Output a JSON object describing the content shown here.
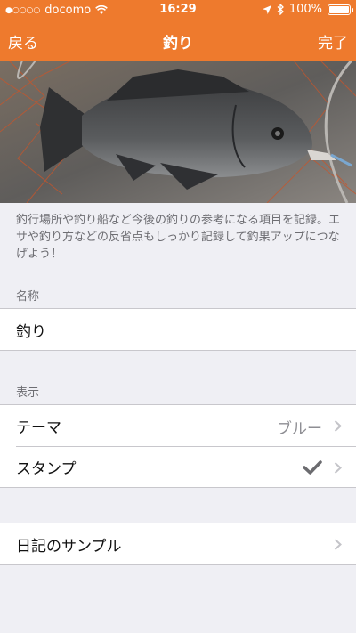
{
  "status_bar": {
    "carrier": "docomo",
    "time": "16:29",
    "battery": "100%"
  },
  "nav": {
    "back_label": "戻る",
    "title": "釣り",
    "done_label": "完了"
  },
  "description": "釣行場所や釣り船など今後の釣りの参考になる項目を記録。エサや釣り方などの反省点もしっかり記録して釣果アップにつなげよう！",
  "name_section": {
    "header": "名称",
    "value": "釣り"
  },
  "display_section": {
    "header": "表示",
    "theme_label": "テーマ",
    "theme_value": "ブルー",
    "stamp_label": "スタンプ"
  },
  "sample_label": "日記のサンプル",
  "colors": {
    "accent": "#ee7a2d",
    "background": "#efeff4"
  }
}
